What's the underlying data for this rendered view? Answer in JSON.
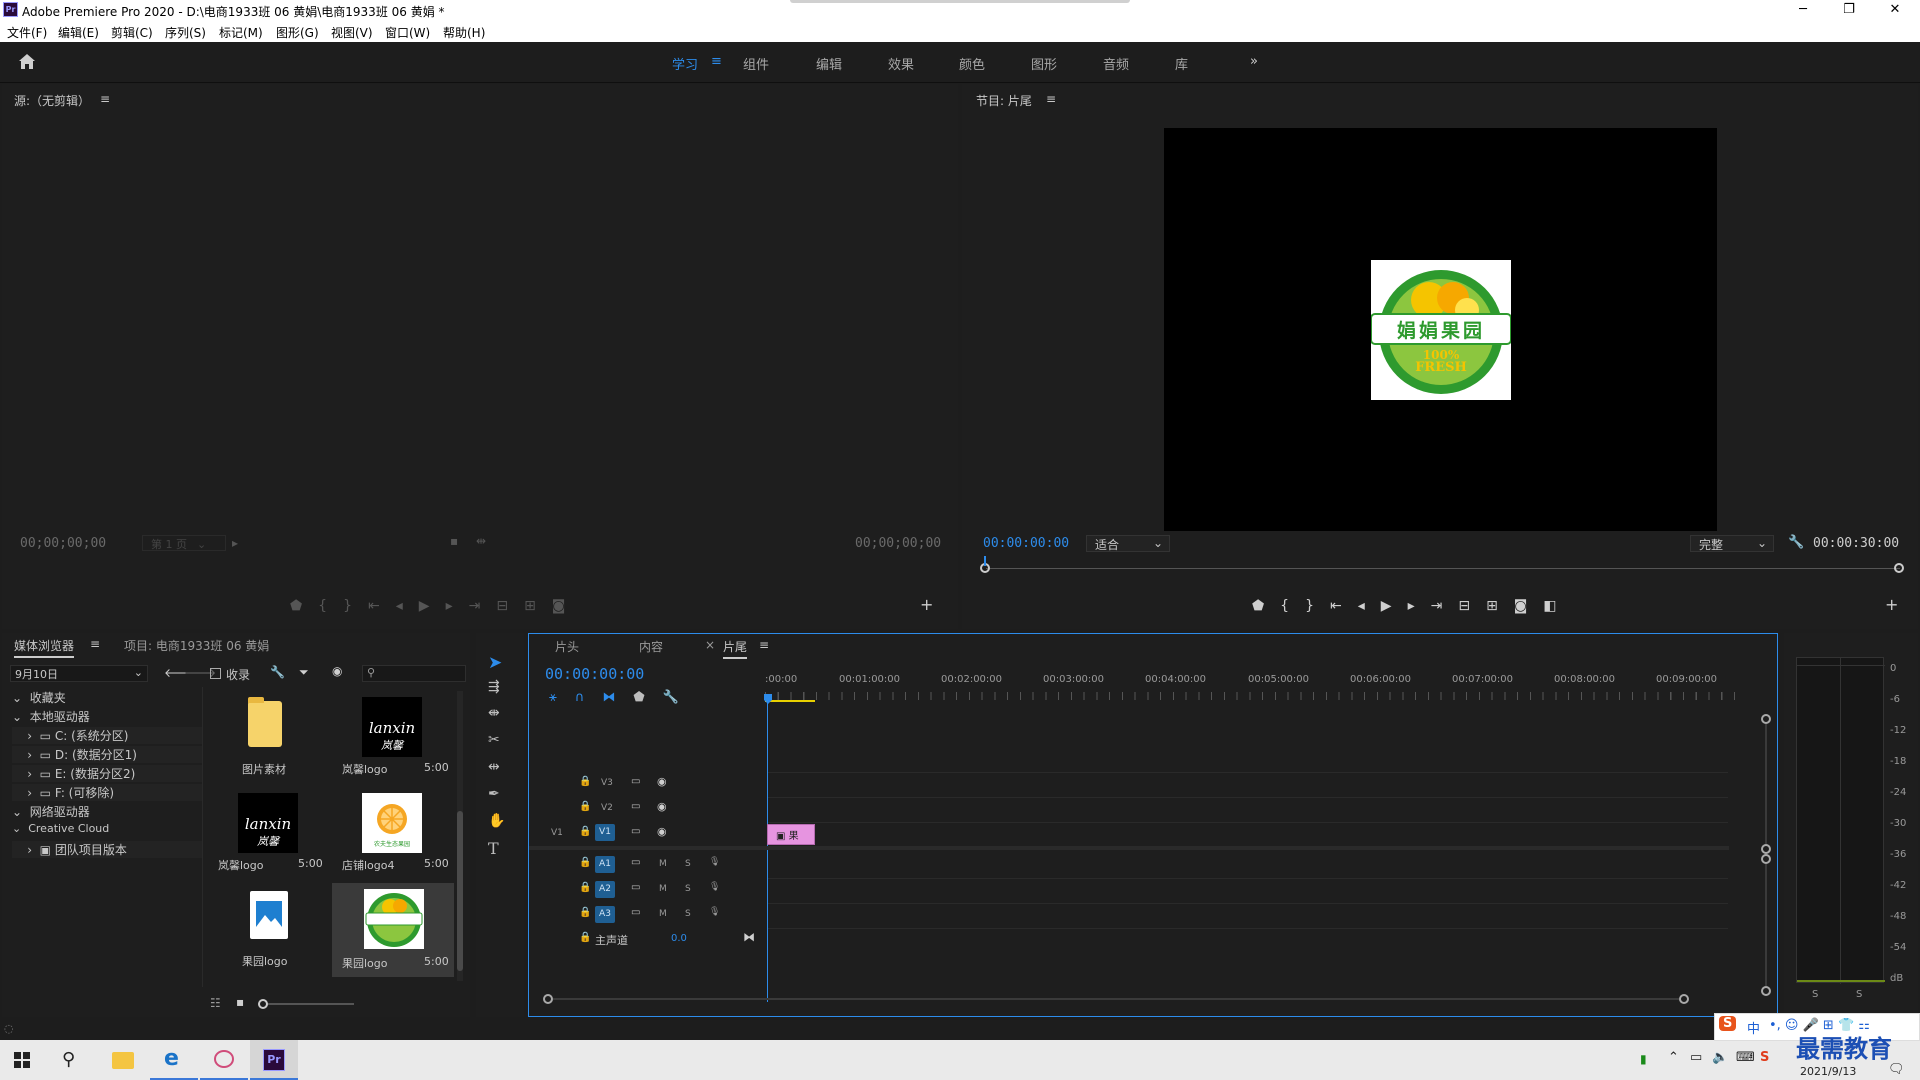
{
  "window": {
    "title": "Adobe Premiere Pro 2020 - D:\\电商1933班  06  黄娟\\电商1933班  06  黄娟 *",
    "app_icon": "Pr"
  },
  "menu": [
    "文件(F)",
    "编辑(E)",
    "剪辑(C)",
    "序列(S)",
    "标记(M)",
    "图形(G)",
    "视图(V)",
    "窗口(W)",
    "帮助(H)"
  ],
  "workspaces": {
    "tabs": [
      "学习",
      "组件",
      "编辑",
      "效果",
      "颜色",
      "图形",
      "音频",
      "库"
    ],
    "active": "学习",
    "more": "»"
  },
  "source_panel": {
    "title": "源:（无剪辑）",
    "timecode_left": "00;00;00;00",
    "page": "第 1 页",
    "timecode_right": "00;00;00;00"
  },
  "program_panel": {
    "title": "节目: 片尾",
    "timecode": "00:00:00:00",
    "fit": "适合",
    "quality": "完整",
    "duration": "00:00:30:00",
    "logo": {
      "title": "娟娟果园",
      "line1": "100%",
      "line2": "FRESH"
    }
  },
  "media_browser": {
    "tab_active": "媒体浏览器",
    "tab_project": "项目: 电商1933班  06  黄娟",
    "folder_select": "9月10日",
    "checkbox_label": "收录",
    "tree": [
      {
        "label": "收藏夹",
        "level": 0
      },
      {
        "label": "本地驱动器",
        "level": 0
      },
      {
        "label": "C: (系统分区)",
        "level": 1
      },
      {
        "label": "D: (数据分区1)",
        "level": 1
      },
      {
        "label": "E: (数据分区2)",
        "level": 1
      },
      {
        "label": "F: (可移除)",
        "level": 1
      },
      {
        "label": "网络驱动器",
        "level": 0
      },
      {
        "label": "Creative Cloud",
        "level": 0
      },
      {
        "label": "团队项目版本",
        "level": 1
      }
    ],
    "thumbnails": [
      {
        "name": "图片素材",
        "duration": "",
        "kind": "folder"
      },
      {
        "name": "岚馨logo",
        "duration": "5:00",
        "kind": "lanxin"
      },
      {
        "name": "岚馨logo",
        "duration": "5:00",
        "kind": "lanxin"
      },
      {
        "name": "店铺logo4",
        "duration": "5:00",
        "kind": "orange",
        "caption": "农夫生态果园"
      },
      {
        "name": "果园logo",
        "duration": "",
        "kind": "image"
      },
      {
        "name": "果园logo",
        "duration": "5:00",
        "kind": "fruitlogo"
      }
    ],
    "lanxin_text": "lanxin",
    "lanxin_sub": "岚馨"
  },
  "timeline": {
    "tabs": [
      "片头",
      "内容",
      "片尾"
    ],
    "active_tab": "片尾",
    "timecode": "00:00:00:00",
    "ruler": [
      ":00:00",
      "00:01:00:00",
      "00:02:00:00",
      "00:03:00:00",
      "00:04:00:00",
      "00:05:00:00",
      "00:06:00:00",
      "00:07:00:00",
      "00:08:00:00",
      "00:09:00:00"
    ],
    "video_tracks": [
      "V3",
      "V2",
      "V1"
    ],
    "audio_tracks": [
      "A1",
      "A2",
      "A3"
    ],
    "source_patch": "V1",
    "master": {
      "label": "主声道",
      "value": "0.0"
    },
    "clip_label": "果",
    "track_m": "M",
    "track_s": "S"
  },
  "audio_meter": {
    "scale": [
      "0",
      "-6",
      "-12",
      "-18",
      "-24",
      "-30",
      "-36",
      "-42",
      "-48",
      "-54",
      "dB"
    ],
    "solo": [
      "S",
      "S"
    ]
  },
  "taskbar": {
    "date": "2021/9/13",
    "ime": "中",
    "watermark": "最需教育"
  },
  "colors": {
    "accent_blue": "#2d8ceb",
    "panel": "#1e1e1e",
    "clip_pink": "#e694e0",
    "track_blue": "#1f5f93"
  }
}
